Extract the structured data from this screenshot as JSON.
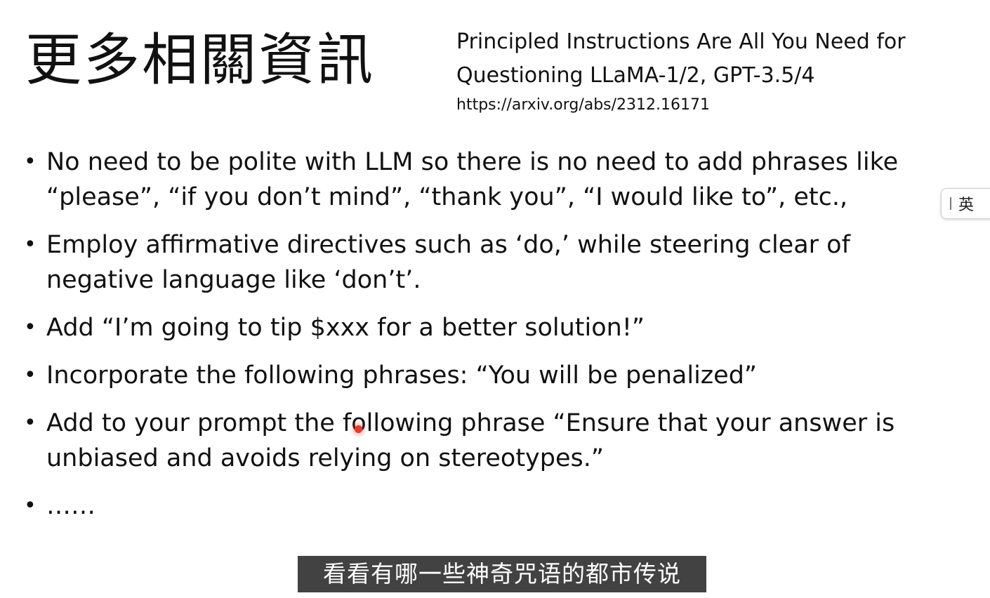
{
  "slide": {
    "title": "更多相關資訊",
    "reference": {
      "title_line1": "Principled Instructions Are All You Need for",
      "title_line2": "Questioning LLaMA-1/2, GPT-3.5/4",
      "url": "https://arxiv.org/abs/2312.16171"
    },
    "bullets": [
      {
        "line1": "No need to be polite with LLM so there is no need to add phrases like",
        "line2": "“please”, “if you don’t mind”, “thank you”, “I would like to”, etc.,"
      },
      {
        "line1": "Employ affirmative directives such as ‘do,’ while steering clear of",
        "line2": "negative language like ‘don’t’."
      },
      {
        "line1": "Add “I’m going to tip $xxx for a better solution!”"
      },
      {
        "line1": "Incorporate the following phrases: “You will be penalized”"
      },
      {
        "line1": "Add to your prompt the following phrase “Ensure that your answer is",
        "line2": "unbiased and avoids relying on stereotypes.”"
      },
      {
        "line1": "……"
      }
    ],
    "bullet_symbol": "•"
  },
  "ime_indicator": {
    "mode_label": "英"
  },
  "subtitle": {
    "text": "看看有哪一些神奇咒语的都市传说"
  },
  "colors": {
    "background": "#ffffff",
    "text": "#111111",
    "subtitle_bg": "#282828",
    "cursor_highlight": "#e8392b"
  }
}
